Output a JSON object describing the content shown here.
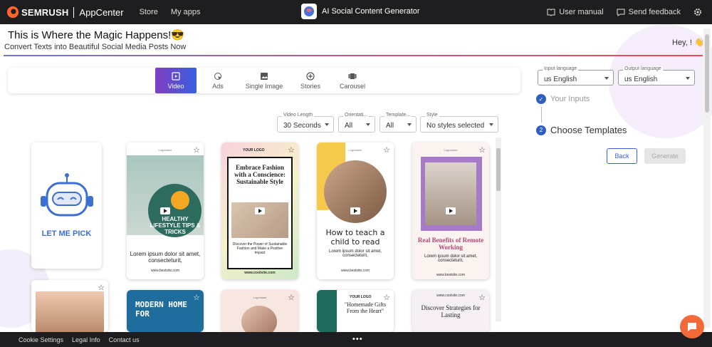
{
  "topbar": {
    "brand": "SEMRUSH",
    "appcenter": "AppCenter",
    "nav": [
      "Store",
      "My apps"
    ],
    "app_title": "AI Social Content Generator",
    "user_manual": "User manual",
    "send_feedback": "Send feedback"
  },
  "header": {
    "headline": "This is Where the Magic Happens!😎",
    "subheadline": "Convert Texts into Beautiful Social Media Posts Now",
    "greeting": "Hey, ! 👋"
  },
  "tabs": [
    {
      "label": "Video",
      "icon": "video-icon",
      "active": true
    },
    {
      "label": "Ads",
      "icon": "cursor-click-icon"
    },
    {
      "label": "Single Image",
      "icon": "image-icon"
    },
    {
      "label": "Stories",
      "icon": "plus-circle-icon"
    },
    {
      "label": "Carousel",
      "icon": "carousel-icon"
    }
  ],
  "filters": {
    "video_length": {
      "label": "Video Length",
      "value": "30 Seconds"
    },
    "orientation": {
      "label": "Orientati...",
      "value": "All"
    },
    "template": {
      "label": "Template...",
      "value": "All"
    },
    "style": {
      "label": "Style",
      "value": "No styles selected"
    }
  },
  "language": {
    "input": {
      "label": "Input language",
      "value": "us English"
    },
    "output": {
      "label": "Output language",
      "value": "us English"
    }
  },
  "steps": {
    "step1": "Your Inputs",
    "step2_number": "2",
    "step2": "Choose Templates"
  },
  "buttons": {
    "back": "Back",
    "generate": "Generate"
  },
  "templates": {
    "let_me_pick": "LET ME PICK",
    "logoname": "Logoname",
    "your_logo": "YOUR LOGO",
    "t1": {
      "badge": "HEALTHY LIFESTYLE TIPS & TRICKS",
      "text": "Lorem ipsum dolor sit amet, consecteturit,",
      "url": "www.bestsite.com"
    },
    "t2": {
      "title": "Embrace Fashion with a Conscience: Sustainable Style",
      "text": "Discover the Power of Sustainable Fashion and Make a Positive Impact",
      "url": "www.coolsite.com"
    },
    "t3": {
      "title": "How to teach a child to read",
      "text": "Lorem ipsum dolor sit amet, consecteturit,",
      "url": "www.bestsite.com"
    },
    "t4": {
      "title": "Real Benefits of Remote Working",
      "text": "Lorem ipsum dolor sit amet, consecteturit,",
      "url": "www.bestsite.com"
    },
    "t6": {
      "title": "MODERN HOME FOR"
    },
    "t8": {
      "title": "\"Homemade Gifts From the Heart\""
    },
    "t9": {
      "url": "www.coolsite.com",
      "title": "Discover Strategies for Lasting"
    }
  },
  "footer": {
    "links": [
      "Cookie Settings",
      "Legal Info",
      "Contact us"
    ],
    "more": "•••"
  },
  "colors": {
    "accent": "#3a5fe0",
    "brand_orange": "#ff642d",
    "chat": "#f26a3a"
  }
}
